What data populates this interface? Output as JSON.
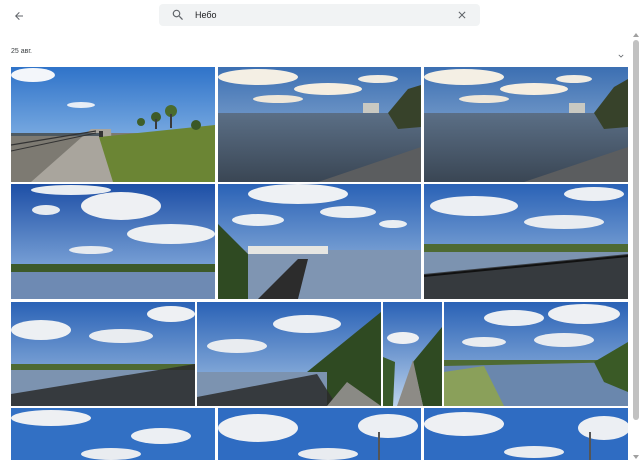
{
  "search": {
    "value": "Небо",
    "placeholder": ""
  },
  "section": {
    "date_label": "25 авг."
  },
  "icons": {
    "back": "arrow-back-icon",
    "search": "search-icon",
    "clear": "close-icon",
    "collapse": "chevron-down-icon"
  },
  "colors": {
    "search_bg": "#f1f3f4",
    "text": "#202124"
  }
}
